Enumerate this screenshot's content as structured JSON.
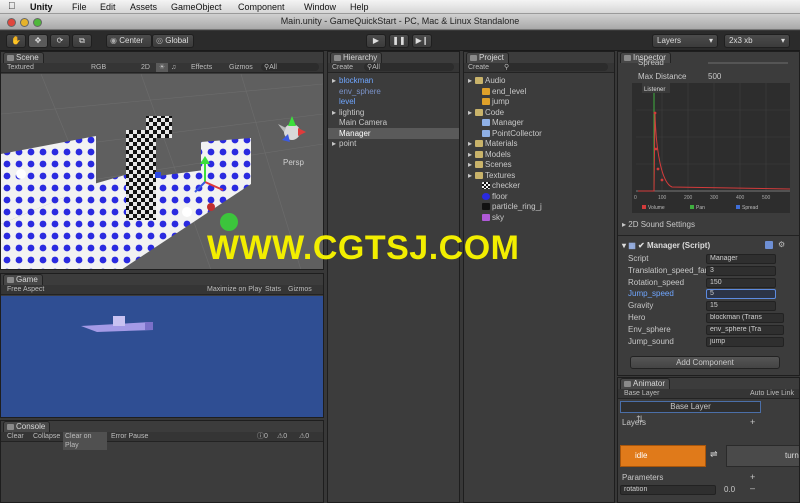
{
  "menubar": {
    "items": [
      "Unity",
      "File",
      "Edit",
      "Assets",
      "GameObject",
      "Component",
      "Window",
      "Help"
    ]
  },
  "window": {
    "title": "Main.unity - GameQuickStart - PC, Mac & Linux Standalone"
  },
  "toolbar": {
    "pivot_label": "Center",
    "space_label": "Global",
    "layers_label": "Layers",
    "layout_label": "2x3 xb"
  },
  "scene": {
    "tab": "Scene",
    "shading": "Textured",
    "rgb": "RGB",
    "mode2d": "2D",
    "effects": "Effects",
    "gizmos": "Gizmos",
    "search": "All",
    "persp": "Persp"
  },
  "game": {
    "tab": "Game",
    "aspect": "Free Aspect",
    "maximize": "Maximize on Play",
    "stats": "Stats",
    "gizmos": "Gizmos"
  },
  "console": {
    "tab": "Console",
    "buttons": [
      "Clear",
      "Collapse",
      "Clear on Play",
      "Error Pause"
    ],
    "counts": [
      "0",
      "0",
      "0"
    ]
  },
  "hierarchy": {
    "tab": "Hierarchy",
    "create": "Create",
    "search": "All",
    "items": [
      {
        "label": "blockman",
        "style": "blue",
        "arrow": true
      },
      {
        "label": "env_sphere",
        "style": "dimblue",
        "arrow": false
      },
      {
        "label": "level",
        "style": "blue",
        "arrow": false
      },
      {
        "label": "lighting",
        "style": "normal",
        "arrow": true
      },
      {
        "label": "Main Camera",
        "style": "normal",
        "arrow": false
      },
      {
        "label": "Manager",
        "style": "selected",
        "arrow": false
      },
      {
        "label": "point",
        "style": "normal",
        "arrow": true
      }
    ]
  },
  "project": {
    "tab": "Project",
    "create": "Create",
    "items": [
      {
        "label": "Audio",
        "depth": 0,
        "type": "folder"
      },
      {
        "label": "end_level",
        "depth": 1,
        "type": "audio"
      },
      {
        "label": "jump",
        "depth": 1,
        "type": "audio"
      },
      {
        "label": "Code",
        "depth": 0,
        "type": "folder"
      },
      {
        "label": "Manager",
        "depth": 1,
        "type": "script"
      },
      {
        "label": "PointCollector",
        "depth": 1,
        "type": "script"
      },
      {
        "label": "Materials",
        "depth": 0,
        "type": "folder"
      },
      {
        "label": "Models",
        "depth": 0,
        "type": "folder"
      },
      {
        "label": "Scenes",
        "depth": 0,
        "type": "folder"
      },
      {
        "label": "Textures",
        "depth": 0,
        "type": "folder"
      },
      {
        "label": "checker",
        "depth": 1,
        "type": "checker"
      },
      {
        "label": "floor",
        "depth": 1,
        "type": "floor"
      },
      {
        "label": "particle_ring_j",
        "depth": 1,
        "type": "particle"
      },
      {
        "label": "sky",
        "depth": 1,
        "type": "sky"
      }
    ]
  },
  "inspector": {
    "tab": "Inspector",
    "spread_label": "Spread",
    "max_distance_label": "Max Distance",
    "max_distance_value": "500",
    "graph_listener": "Listener",
    "graph_ticks": [
      "0",
      "100",
      "200",
      "300",
      "400",
      "500"
    ],
    "graph_legend": [
      "Volume",
      "Pan",
      "Spread"
    ],
    "graph_colors": [
      "#d33b3b",
      "#3fae3f",
      "#3f6ed8"
    ],
    "sound_settings": "2D Sound Settings",
    "component_title": "Manager (Script)",
    "fields": [
      {
        "label": "Script",
        "value": "Manager",
        "highlight": false
      },
      {
        "label": "Translation_speed_far",
        "value": "3",
        "highlight": false
      },
      {
        "label": "Rotation_speed",
        "value": "150",
        "highlight": false
      },
      {
        "label": "Jump_speed",
        "value": "5",
        "highlight": true
      },
      {
        "label": "Gravity",
        "value": "15",
        "highlight": false
      },
      {
        "label": "Hero",
        "value": "blockman (Trans",
        "highlight": false
      },
      {
        "label": "Env_sphere",
        "value": "env_sphere (Tra",
        "highlight": false
      },
      {
        "label": "Jump_sound",
        "value": "jump",
        "highlight": false
      }
    ],
    "add_component": "Add Component"
  },
  "animator": {
    "tab": "Animator",
    "base_layer": "Base Layer",
    "auto_live": "Auto Live Link",
    "layer_name": "Base Layer",
    "layers_label": "Layers",
    "state_idle": "idle",
    "state_turn": "turn",
    "params_label": "Parameters",
    "param_name": "rotation",
    "param_value": "0.0"
  },
  "watermark": "WWW.CGTSJ.COM"
}
